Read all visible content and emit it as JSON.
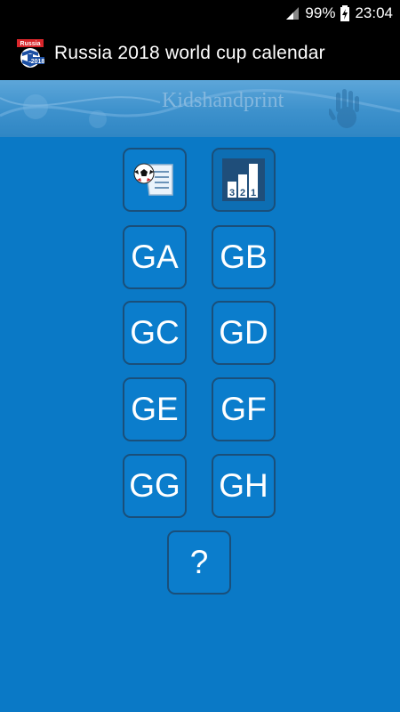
{
  "status_bar": {
    "battery": "99%",
    "time": "23:04"
  },
  "app_bar": {
    "title": "Russia 2018 world cup calendar",
    "logo_text_top": "Russia",
    "logo_text_bottom": "2018"
  },
  "banner": {
    "watermark": "Kidshandprint"
  },
  "buttons": {
    "schedule_icon": "ball-and-list-icon",
    "standings_icon": "podium-chart-icon",
    "podium_numbers": "3 2 1",
    "groups": [
      "GA",
      "GB",
      "GC",
      "GD",
      "GE",
      "GF",
      "GG",
      "GH"
    ],
    "help": "?"
  },
  "colors": {
    "background": "#0a79c6",
    "tile_border": "#1a4f7a",
    "bar": "#000000"
  }
}
